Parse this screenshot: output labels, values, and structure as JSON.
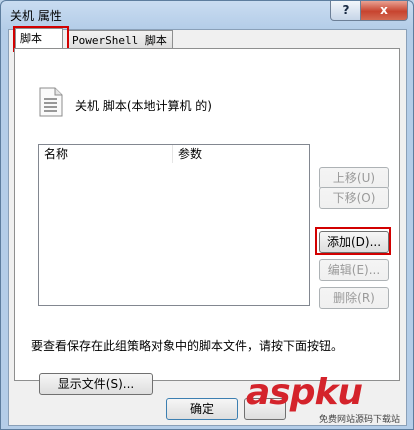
{
  "window": {
    "title": "关机 属性",
    "help_label": "?",
    "close_label": "x"
  },
  "tabs": [
    {
      "label": "脚本",
      "active": true
    },
    {
      "label": "PowerShell 脚本",
      "active": false
    }
  ],
  "heading": "关机 脚本(本地计算机 的)",
  "table": {
    "columns": [
      "名称",
      "参数"
    ],
    "rows": []
  },
  "side_buttons": {
    "up": "上移(U)",
    "down": "下移(O)",
    "add": "添加(D)...",
    "edit": "编辑(E)...",
    "delete": "删除(R)"
  },
  "info_text": "要查看保存在此组策略对象中的脚本文件，请按下面按钮。",
  "show_files_label": "显示文件(S)...",
  "footer": {
    "ok_label": "确定"
  },
  "watermark": {
    "brand": "aspku",
    "subtitle": "免费网站源码下载站"
  },
  "colors": {
    "highlight_box": "#d20000",
    "close_button": "#c7442f"
  }
}
